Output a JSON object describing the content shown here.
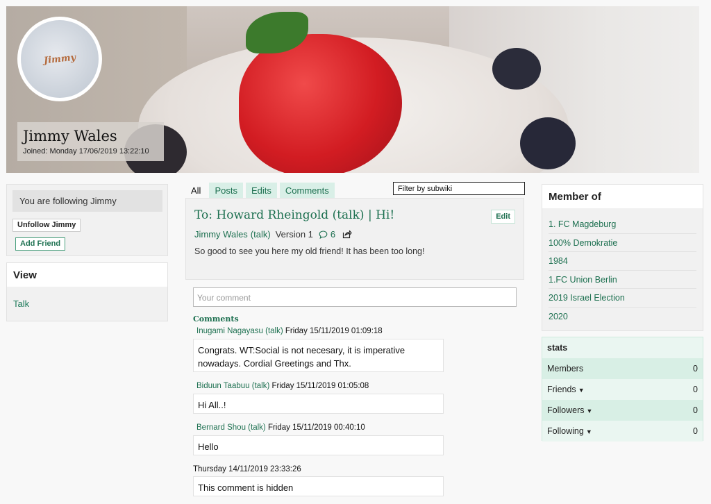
{
  "profile": {
    "name": "Jimmy Wales",
    "joined": "Joined: Monday 17/06/2019 13:22:10",
    "avatar_text": "Jimmy"
  },
  "sidebar": {
    "following_text": "You are following Jimmy",
    "unfollow_label": "Unfollow Jimmy",
    "add_friend_label": "Add Friend",
    "view_title": "View",
    "view_link": "Talk"
  },
  "tabs": [
    "All",
    "Posts",
    "Edits",
    "Comments"
  ],
  "filter": {
    "value": "Filter by subwiki"
  },
  "post": {
    "title": "To: Howard Rheingold (talk) | Hi!",
    "edit_label": "Edit",
    "author": "Jimmy Wales",
    "talk": "(talk)",
    "version": "Version 1",
    "comment_count": "6",
    "body": "So good to see you here my old friend! It has been too long!"
  },
  "comment_box": {
    "placeholder": "Your comment"
  },
  "comments_label": "Comments",
  "comments": [
    {
      "author": "Inugami Nagayasu",
      "talk": "(talk)",
      "date": "Friday 15/11/2019 01:09:18",
      "text": "Congrats. WT:Social is not necesary, it is imperative nowadays. Cordial Greetings and Thx."
    },
    {
      "author": "Biduun Taabuu",
      "talk": "(talk)",
      "date": "Friday 15/11/2019 01:05:08",
      "text": "Hi All..!"
    },
    {
      "author": "Bernard Shou",
      "talk": "(talk)",
      "date": "Friday 15/11/2019 00:40:10",
      "text": "Hello"
    },
    {
      "author": "",
      "talk": "",
      "date": "Thursday 14/11/2019 23:33:26",
      "text": "This comment is hidden"
    }
  ],
  "member_of": {
    "title": "Member of",
    "items": [
      "1. FC Magdeburg",
      "100% Demokratie",
      "1984",
      "1.FC Union Berlin",
      "2019 Israel Election",
      "2020"
    ]
  },
  "stats": {
    "title": "stats",
    "rows": [
      {
        "label": "Members",
        "value": "0"
      },
      {
        "label": "Friends",
        "value": "0"
      },
      {
        "label": "Followers",
        "value": "0"
      },
      {
        "label": "Following",
        "value": "0"
      }
    ]
  },
  "colors": {
    "accent": "#1d7050",
    "tab_bg": "#d9efe7",
    "stats_alt": "#d8efe5"
  }
}
